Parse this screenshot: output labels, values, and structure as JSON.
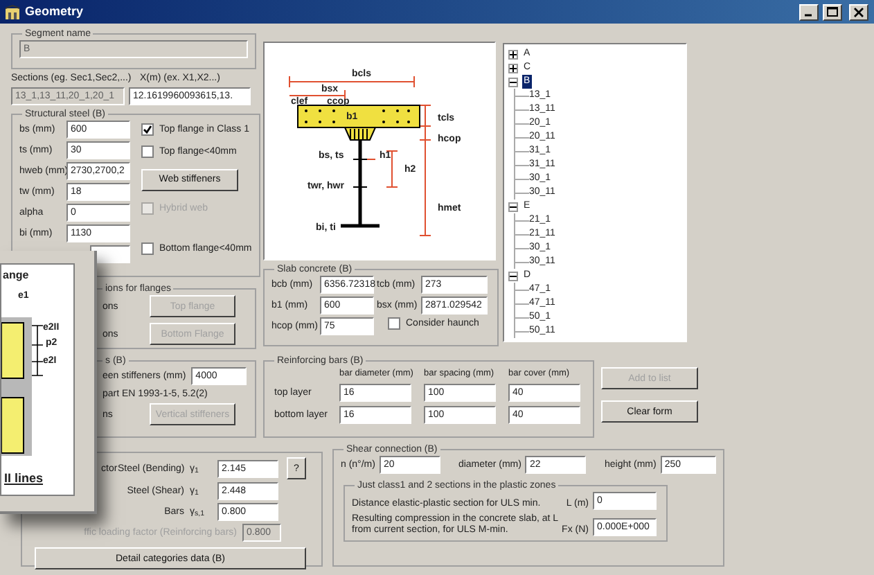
{
  "window": {
    "title": "Geometry"
  },
  "segment": {
    "title": "Segment name",
    "value": "B",
    "disabled": true
  },
  "sections": {
    "label": "Sections (eg. Sec1,Sec2,...)",
    "value": "13_1,13_11,20_1,20_1",
    "disabled": true
  },
  "x_positions": {
    "label": "X(m) (ex. X1,X2...)",
    "value": "12.1619960093615,13."
  },
  "structural_steel": {
    "title": "Structural steel  (B)",
    "fields": [
      {
        "label": "bs (mm)",
        "value": "600"
      },
      {
        "label": "ts (mm)",
        "value": "30"
      },
      {
        "label": "hweb (mm)",
        "value": "2730,2700,2"
      },
      {
        "label": "tw (mm)",
        "value": "18"
      },
      {
        "label": "alpha",
        "value": "0"
      },
      {
        "label": "bi (mm)",
        "value": "1130"
      }
    ],
    "controls": [
      {
        "kind": "checkbox",
        "label": "Top flange in Class 1",
        "checked": true,
        "disabled": false
      },
      {
        "kind": "checkbox",
        "label": "Top flange<40mm",
        "checked": false,
        "disabled": false
      },
      {
        "kind": "button",
        "label": "Web stiffeners",
        "disabled": false
      },
      {
        "kind": "checkbox",
        "label": "Hybrid web",
        "checked": false,
        "disabled": true
      },
      {
        "kind": "checkbox",
        "label": "Bottom flange<40mm",
        "checked": false,
        "disabled": false
      }
    ]
  },
  "flanges": {
    "title": "ions for flanges",
    "rows": [
      {
        "label": "ons",
        "button": "Top flange",
        "disabled": true
      },
      {
        "label": "ons",
        "button": "Bottom Flange",
        "disabled": true
      }
    ]
  },
  "stiffeners": {
    "title": "s (B)",
    "field": {
      "label": "een stiffeners (mm)",
      "value": "4000"
    },
    "note": "part EN 1993-1-5, 5.2(2)",
    "label": "ns",
    "button": "Vertical stiffeners",
    "disabled": true
  },
  "safety": {
    "label": "ctor",
    "rows": [
      {
        "label": "Steel (Bending)",
        "symbol": "γ$_{1}$",
        "value": "2.145"
      },
      {
        "label": "Steel (Shear)",
        "symbol": "γ$_{1}$",
        "value": "2.448"
      },
      {
        "label": "Bars",
        "symbol": "γ$_{s,1}$",
        "value": "0.800"
      }
    ],
    "help_button": "?",
    "traffic": {
      "label": "ffic loading factor (Reinforcing bars)",
      "value": "0.800",
      "disabled": true
    },
    "button": "Detail categories data (B)"
  },
  "diagram_labels": [
    "bcls",
    "bsx",
    "clef",
    "ccop",
    "b1",
    "tcls",
    "hcop",
    "bs, ts",
    "h1",
    "h2",
    "twr, hwr",
    "hmet",
    "bi, ti"
  ],
  "slab": {
    "title": "Slab concrete  (B)",
    "fields": [
      {
        "label": "bcb (mm)",
        "value": "6356.72318"
      },
      {
        "label": "tcb (mm)",
        "value": "273"
      },
      {
        "label": "b1 (mm)",
        "value": "600"
      },
      {
        "label": "bsx (mm)",
        "value": "2871.029542"
      },
      {
        "label": "hcop (mm)",
        "value": "75"
      }
    ],
    "haunch": {
      "label": "Consider haunch",
      "checked": false
    }
  },
  "reinforcing": {
    "title": "Reinforcing bars  (B)",
    "columns": [
      "bar diameter (mm)",
      "bar spacing (mm)",
      "bar cover (mm)"
    ],
    "rows": [
      {
        "label": "top layer",
        "values": [
          "16",
          "100",
          "40"
        ]
      },
      {
        "label": "bottom layer",
        "values": [
          "16",
          "100",
          "40"
        ]
      }
    ]
  },
  "buttons": [
    {
      "label": "Add to list",
      "disabled": true
    },
    {
      "label": "Clear form",
      "disabled": false
    }
  ],
  "shear": {
    "title": "Shear connection  (B)",
    "fields": [
      {
        "label": "n (n°/m)",
        "value": "20"
      },
      {
        "label": "diameter (mm)",
        "value": "22"
      },
      {
        "label": "height (mm)",
        "value": "250"
      }
    ],
    "plastic": {
      "title": "Just class1 and 2 sections in the plastic zones",
      "rows": [
        {
          "text": "Distance elastic-plastic section for ULS min.",
          "label": "L (m)",
          "value": "0"
        },
        {
          "text": "Resulting compression in the concrete slab, at L from current section, for ULS M-min.",
          "label": "Fx (N)",
          "value": "0.000E+000"
        }
      ]
    }
  },
  "tree": [
    {
      "label": "A",
      "expanded": false,
      "selected": false
    },
    {
      "label": "C",
      "expanded": false,
      "selected": false
    },
    {
      "label": "B",
      "expanded": true,
      "selected": true,
      "children": [
        {
          "label": "13_1"
        },
        {
          "label": "13_11"
        },
        {
          "label": "20_1"
        },
        {
          "label": "20_11"
        },
        {
          "label": "31_1"
        },
        {
          "label": "31_11"
        },
        {
          "label": "30_1"
        },
        {
          "label": "30_11"
        }
      ]
    },
    {
      "label": "E",
      "expanded": true,
      "selected": false,
      "children": [
        {
          "label": "21_1"
        },
        {
          "label": "21_11"
        },
        {
          "label": "30_1"
        },
        {
          "label": "30_11"
        }
      ]
    },
    {
      "label": "D",
      "expanded": true,
      "selected": false,
      "children": [
        {
          "label": "47_1"
        },
        {
          "label": "47_11"
        },
        {
          "label": "50_1"
        },
        {
          "label": "50_11"
        }
      ]
    }
  ],
  "overlay_window": {
    "title": "ange",
    "labels": [
      "e1",
      "e2II",
      "p2",
      "e2I"
    ],
    "caption": "II lines"
  }
}
